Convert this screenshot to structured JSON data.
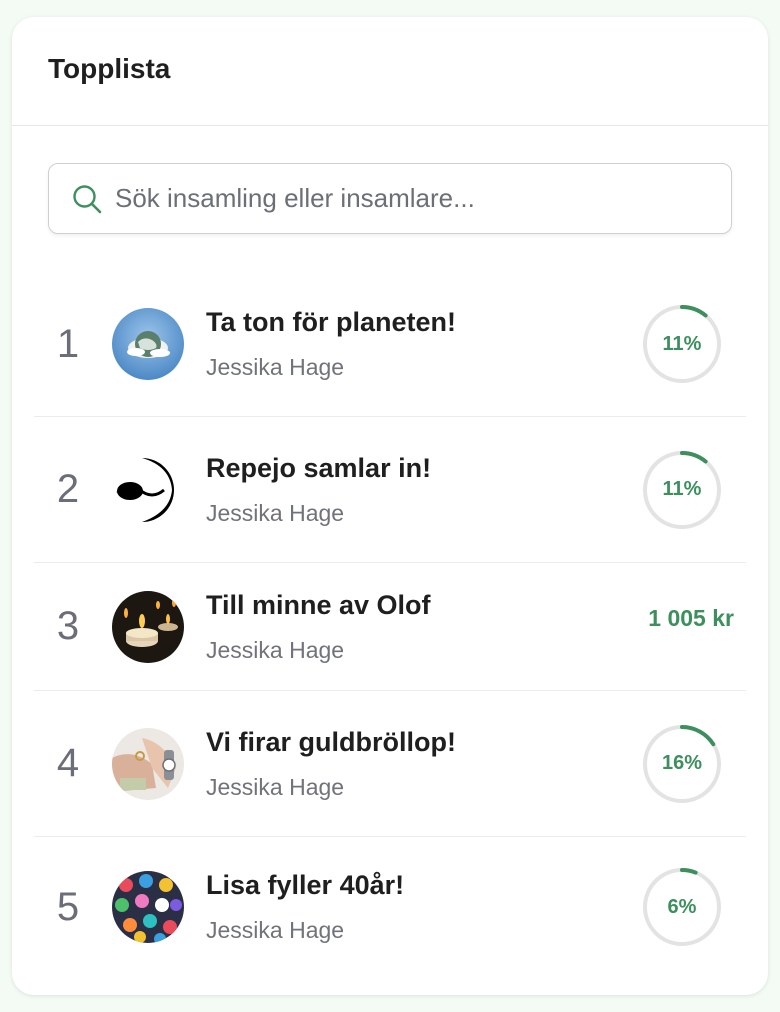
{
  "header": {
    "title": "Topplista"
  },
  "search": {
    "placeholder": "Sök insamling eller insamlare..."
  },
  "colors": {
    "accent": "#3d8f5e",
    "ring_track": "#e3e3e3"
  },
  "items": [
    {
      "rank": "1",
      "name": "Ta ton för planeten!",
      "owner": "Jessika Hage",
      "type": "progress",
      "progress": 0.11,
      "label": "11%",
      "avatar": "planet-image"
    },
    {
      "rank": "2",
      "name": "Repejo samlar in!",
      "owner": "Jessika Hage",
      "type": "progress",
      "progress": 0.11,
      "label": "11%",
      "avatar": "repejo-logo"
    },
    {
      "rank": "3",
      "name": "Till minne av Olof",
      "owner": "Jessika Hage",
      "type": "amount",
      "label": "1 005 kr",
      "avatar": "candles-image"
    },
    {
      "rank": "4",
      "name": "Vi firar guldbröllop!",
      "owner": "Jessika Hage",
      "type": "progress",
      "progress": 0.16,
      "label": "16%",
      "avatar": "rings-image"
    },
    {
      "rank": "5",
      "name": "Lisa fyller 40år!",
      "owner": "Jessika Hage",
      "type": "progress",
      "progress": 0.06,
      "label": "6%",
      "avatar": "beads-image"
    }
  ]
}
